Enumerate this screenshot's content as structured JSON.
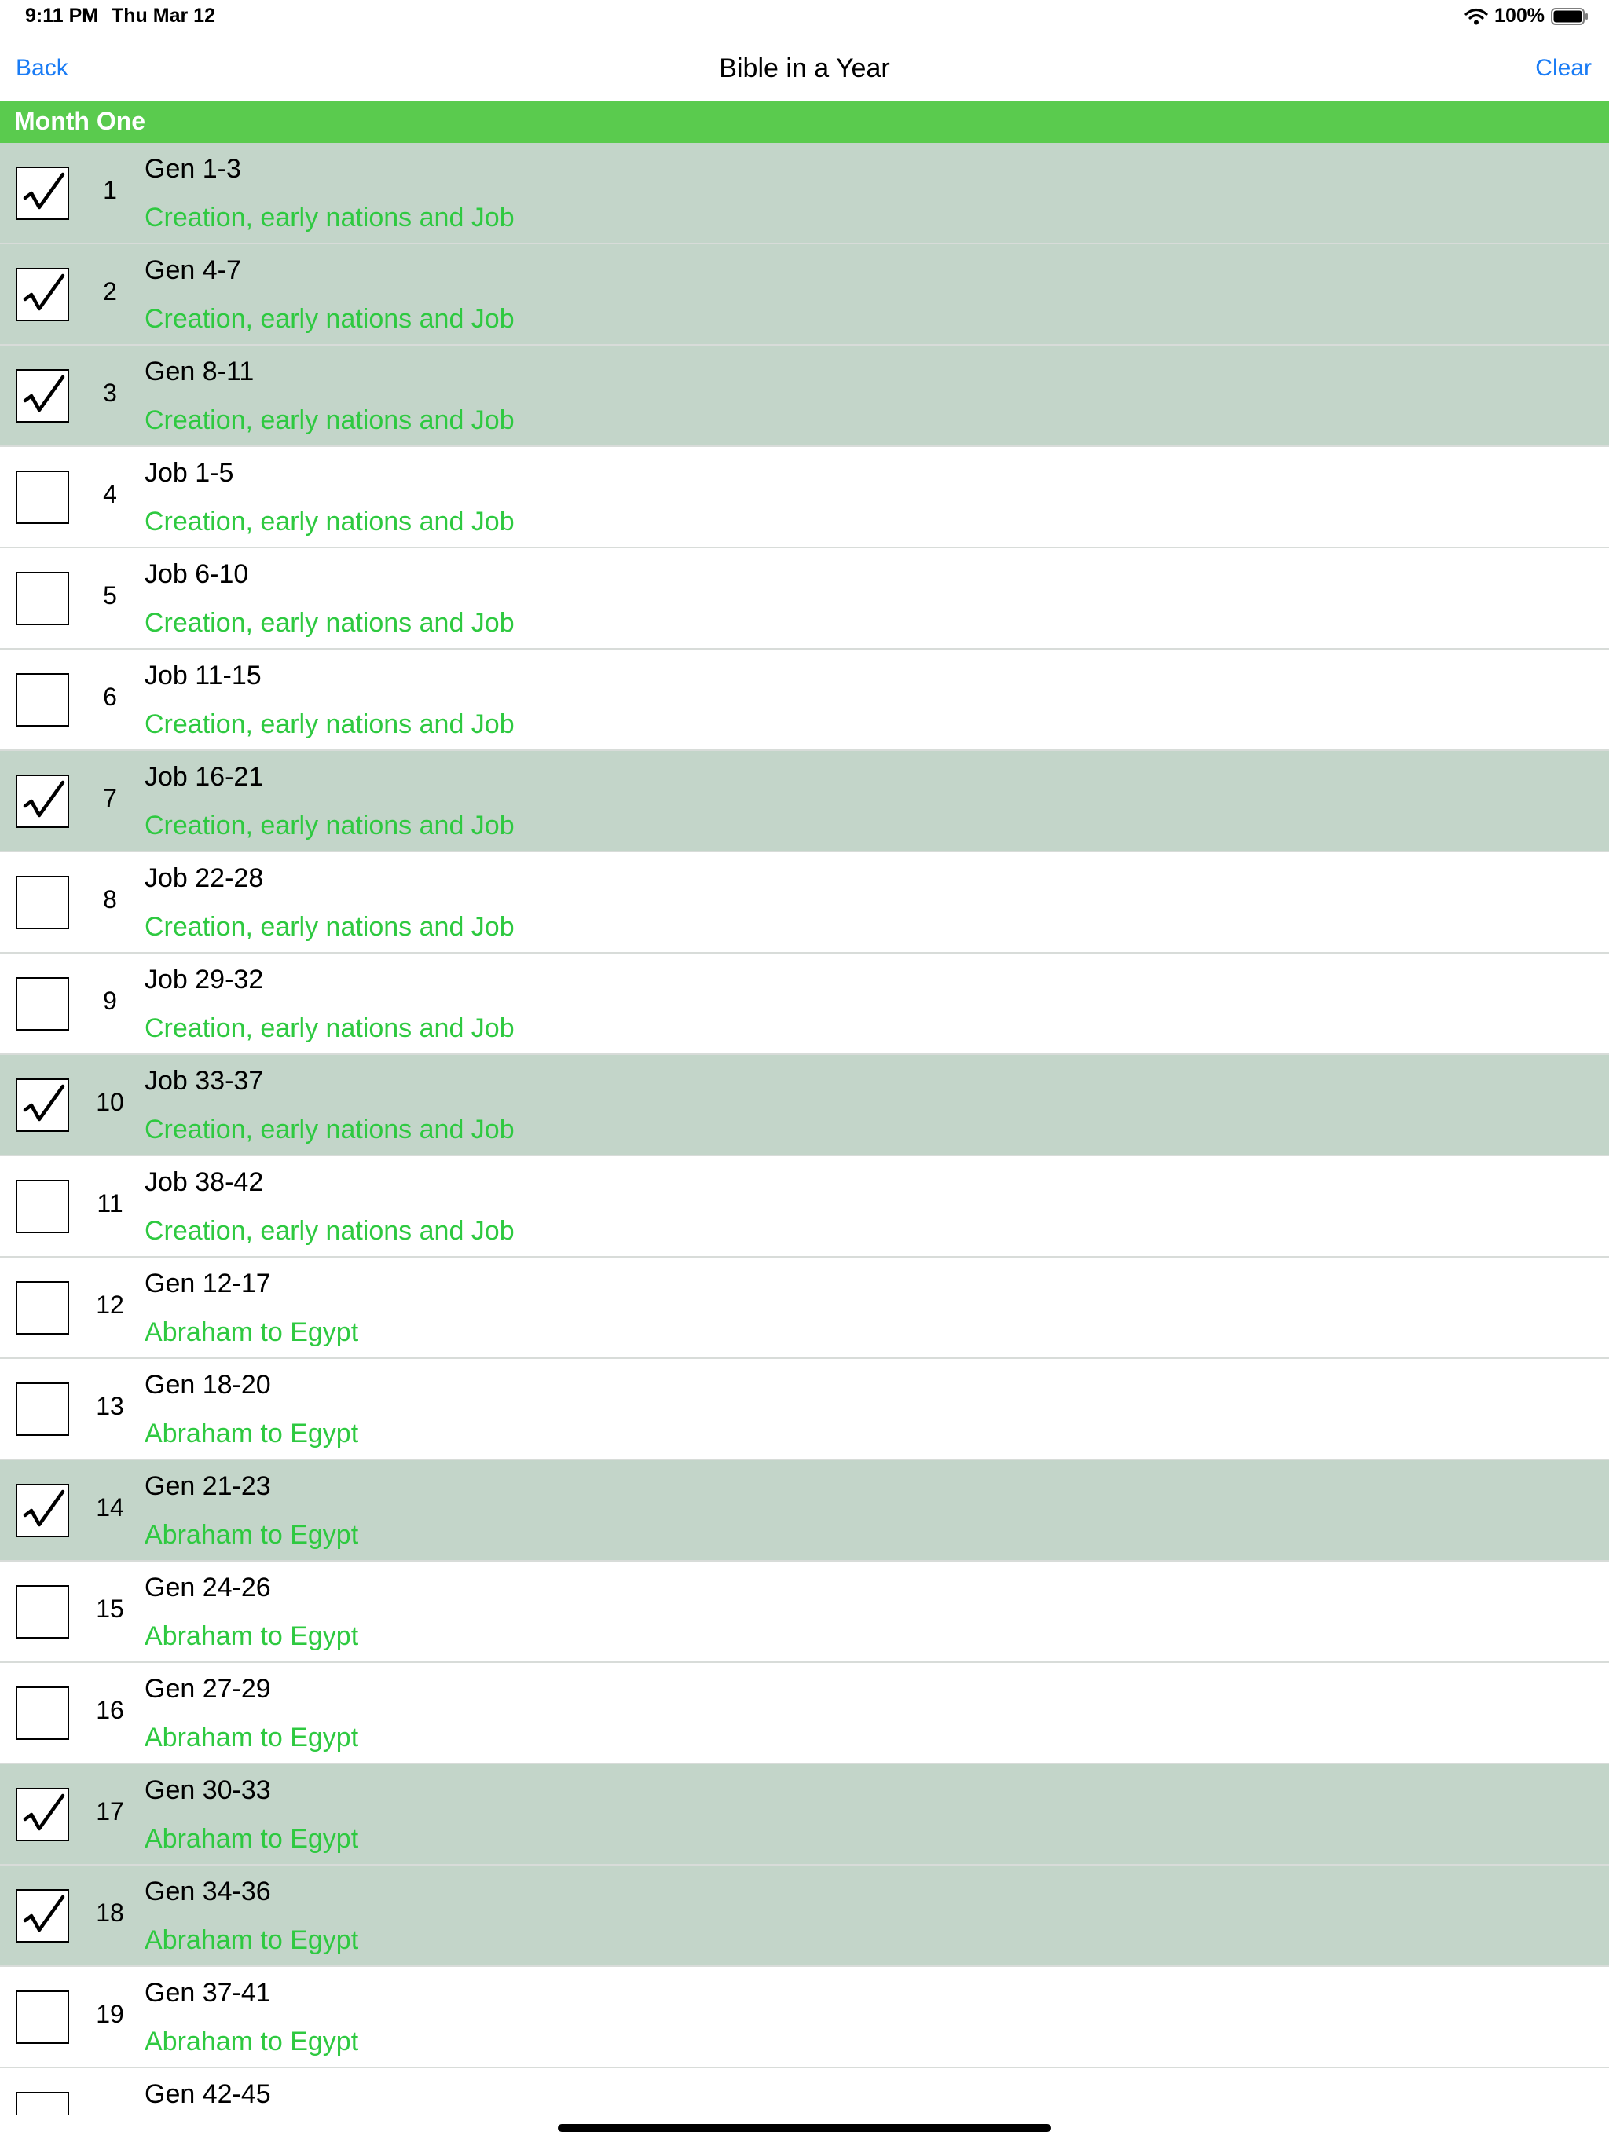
{
  "status_bar": {
    "time": "9:11 PM",
    "date": "Thu Mar 12",
    "battery": "100%"
  },
  "nav": {
    "back_label": "Back",
    "title": "Bible in a Year",
    "clear_label": "Clear"
  },
  "section": {
    "title": "Month One"
  },
  "readings": [
    {
      "day": "1",
      "passage": "Gen 1-3",
      "theme": "Creation, early nations and Job",
      "done": true
    },
    {
      "day": "2",
      "passage": "Gen 4-7",
      "theme": "Creation, early nations and Job",
      "done": true
    },
    {
      "day": "3",
      "passage": "Gen 8-11",
      "theme": "Creation, early nations and Job",
      "done": true
    },
    {
      "day": "4",
      "passage": "Job 1-5",
      "theme": "Creation, early nations and Job",
      "done": false
    },
    {
      "day": "5",
      "passage": "Job 6-10",
      "theme": "Creation, early nations and Job",
      "done": false
    },
    {
      "day": "6",
      "passage": "Job 11-15",
      "theme": "Creation, early nations and Job",
      "done": false
    },
    {
      "day": "7",
      "passage": "Job 16-21",
      "theme": "Creation, early nations and Job",
      "done": true
    },
    {
      "day": "8",
      "passage": "Job 22-28",
      "theme": "Creation, early nations and Job",
      "done": false
    },
    {
      "day": "9",
      "passage": "Job 29-32",
      "theme": "Creation, early nations and Job",
      "done": false
    },
    {
      "day": "10",
      "passage": "Job 33-37",
      "theme": "Creation, early nations and Job",
      "done": true
    },
    {
      "day": "11",
      "passage": "Job 38-42",
      "theme": "Creation, early nations and Job",
      "done": false
    },
    {
      "day": "12",
      "passage": "Gen 12-17",
      "theme": "Abraham to Egypt",
      "done": false
    },
    {
      "day": "13",
      "passage": "Gen 18-20",
      "theme": "Abraham to Egypt",
      "done": false
    },
    {
      "day": "14",
      "passage": "Gen 21-23",
      "theme": "Abraham to Egypt",
      "done": true
    },
    {
      "day": "15",
      "passage": "Gen 24-26",
      "theme": "Abraham to Egypt",
      "done": false
    },
    {
      "day": "16",
      "passage": "Gen 27-29",
      "theme": "Abraham to Egypt",
      "done": false
    },
    {
      "day": "17",
      "passage": "Gen 30-33",
      "theme": "Abraham to Egypt",
      "done": true
    },
    {
      "day": "18",
      "passage": "Gen 34-36",
      "theme": "Abraham to Egypt",
      "done": true
    },
    {
      "day": "19",
      "passage": "Gen 37-41",
      "theme": "Abraham to Egypt",
      "done": false
    },
    {
      "day": "",
      "passage": "Gen 42-45",
      "theme": "",
      "done": false
    }
  ],
  "colors": {
    "accent": "#1a7cf5",
    "section_header": "#5acb4e",
    "theme_text": "#2ec940",
    "done_row": "#c3d5c9"
  }
}
